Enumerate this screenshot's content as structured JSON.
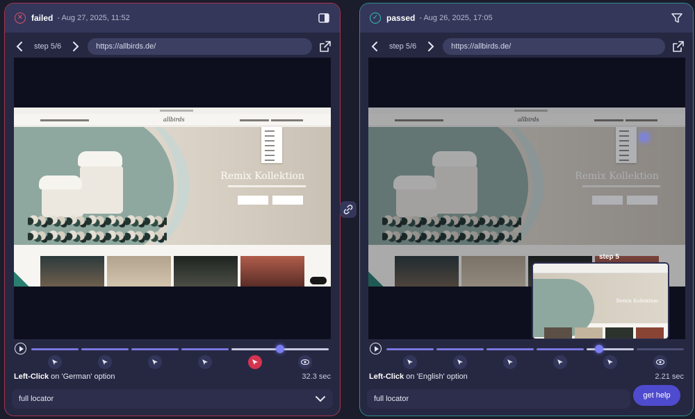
{
  "left": {
    "status": "failed",
    "date": "- Aug 27, 2025, 11:52",
    "step": "step 5/6",
    "url": "https://allbirds.de/",
    "action_verb": "Left-Click",
    "action_target": " on 'German' option",
    "duration": "32.3 sec",
    "locator_label": "full locator",
    "site": {
      "logo": "allbirds",
      "hero_title": "Remix Kollektion"
    },
    "progress": 0.85
  },
  "right": {
    "status": "passed",
    "date": "- Aug 26, 2025, 17:05",
    "step": "step 5/6",
    "url": "https://allbirds.de/",
    "action_verb": "Left-Click",
    "action_target": " on 'English' option",
    "duration": "2.21 sec",
    "locator_label": "full locator",
    "help_label": "get help",
    "preview_label": "step 5",
    "site": {
      "logo": "allbirds",
      "hero_title": "Remix Kollektion"
    },
    "progress": 0.72
  },
  "colors": {
    "failed": "#e0546c",
    "passed": "#36c2b5",
    "accent": "#5b59c9"
  }
}
